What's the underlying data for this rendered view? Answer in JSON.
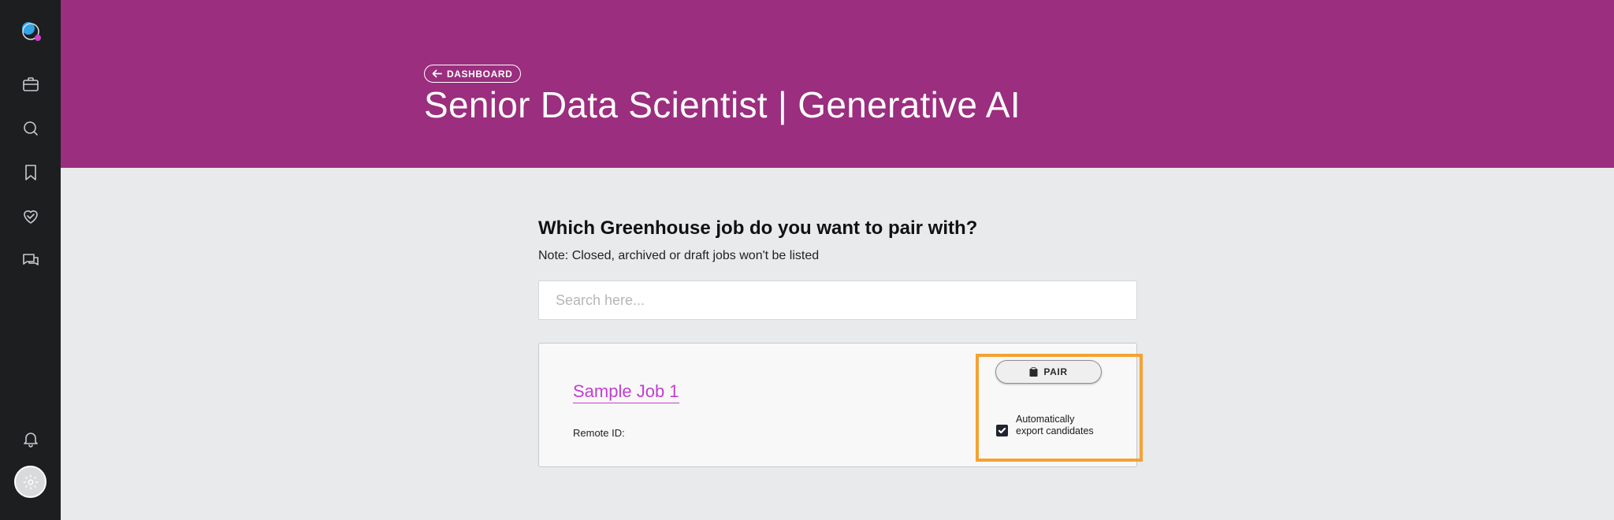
{
  "colors": {
    "sidebar_bg": "#1d1e20",
    "header_bg": "#9b2e7e",
    "page_bg": "#e9eaec",
    "job_link": "#c13fd0",
    "highlight": "#f4a233"
  },
  "sidebar": {
    "items": [
      {
        "icon": "briefcase-icon"
      },
      {
        "icon": "search-icon"
      },
      {
        "icon": "bookmark-icon"
      },
      {
        "icon": "heart-handshake-icon"
      },
      {
        "icon": "chat-icon"
      }
    ],
    "bottom": [
      {
        "icon": "bell-icon"
      },
      {
        "icon": "gear-icon"
      }
    ]
  },
  "header": {
    "back_label": "DASHBOARD",
    "title": "Senior Data Scientist | Generative AI"
  },
  "main": {
    "question": "Which Greenhouse job do you want to pair with?",
    "note": "Note: Closed, archived or draft jobs won't be listed",
    "search_placeholder": "Search here...",
    "jobs": [
      {
        "title": "Sample Job 1",
        "remote_id_label": "Remote ID:",
        "pair_label": "PAIR",
        "auto_export_label": "Automatically export candidates",
        "auto_export_checked": true
      }
    ]
  }
}
